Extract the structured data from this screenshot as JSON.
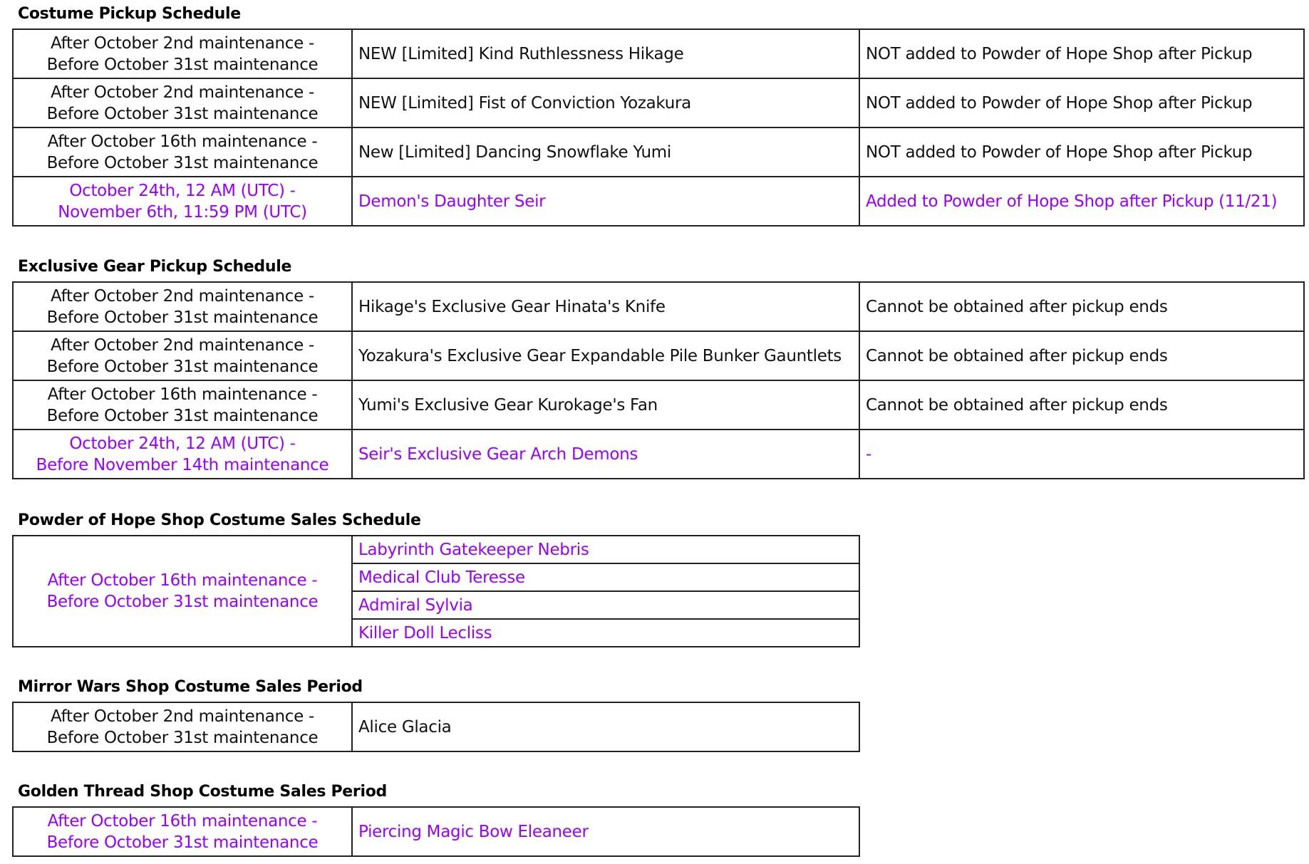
{
  "colors": {
    "highlight": "#9900ff",
    "text": "#111111",
    "border": "#222222"
  },
  "costume_pickup": {
    "title": "Costume Pickup Schedule",
    "rows": [
      {
        "period": [
          "After October 2nd maintenance -",
          "Before October 31st maintenance"
        ],
        "item": "NEW [Limited] Kind Ruthlessness Hikage",
        "note": "NOT added to Powder of Hope Shop after Pickup"
      },
      {
        "period": [
          "After October 2nd maintenance -",
          "Before October 31st maintenance"
        ],
        "item": "NEW [Limited] Fist of Conviction Yozakura",
        "note": "NOT added to Powder of Hope Shop after Pickup"
      },
      {
        "period": [
          "After October 16th maintenance -",
          "Before October 31st maintenance"
        ],
        "item": "New [Limited] Dancing Snowflake Yumi",
        "note": "NOT added to Powder of Hope Shop after Pickup"
      },
      {
        "period": [
          "October 24th, 12 AM (UTC) -",
          "November 6th, 11:59 PM (UTC)"
        ],
        "item": "Demon's Daughter Seir",
        "note": "Added to Powder of Hope Shop after Pickup (11/21)"
      }
    ]
  },
  "exclusive_gear": {
    "title": "Exclusive Gear Pickup Schedule",
    "rows": [
      {
        "period": [
          "After October 2nd maintenance -",
          "Before October 31st maintenance"
        ],
        "item": "Hikage's Exclusive Gear Hinata's Knife",
        "note": "Cannot be obtained after pickup ends"
      },
      {
        "period": [
          "After October 2nd maintenance -",
          "Before October 31st maintenance"
        ],
        "item": "Yozakura's Exclusive Gear Expandable Pile Bunker Gauntlets",
        "note": "Cannot be obtained after pickup ends"
      },
      {
        "period": [
          "After October 16th maintenance -",
          "Before October 31st maintenance"
        ],
        "item": "Yumi's Exclusive Gear Kurokage's Fan",
        "note": "Cannot be obtained after pickup ends"
      },
      {
        "period": [
          "October 24th, 12 AM (UTC) -",
          "Before November 14th maintenance"
        ],
        "item": "Seir's Exclusive Gear Arch Demons",
        "note": "-"
      }
    ]
  },
  "powder_shop": {
    "title": "Powder of Hope Shop Costume Sales Schedule",
    "period": [
      "After October 16th maintenance -",
      "Before October 31st maintenance"
    ],
    "items": [
      "Labyrinth Gatekeeper Nebris",
      "Medical Club Teresse",
      "Admiral Sylvia",
      "Killer Doll Lecliss"
    ]
  },
  "mirror_wars": {
    "title": "Mirror Wars Shop Costume Sales Period",
    "period": [
      "After October 2nd maintenance -",
      "Before October 31st maintenance"
    ],
    "item": "Alice Glacia"
  },
  "golden_thread": {
    "title": "Golden Thread Shop Costume Sales Period",
    "period": [
      "After October 16th maintenance -",
      "Before October 31st maintenance"
    ],
    "item": "Piercing Magic Bow Eleaneer"
  }
}
